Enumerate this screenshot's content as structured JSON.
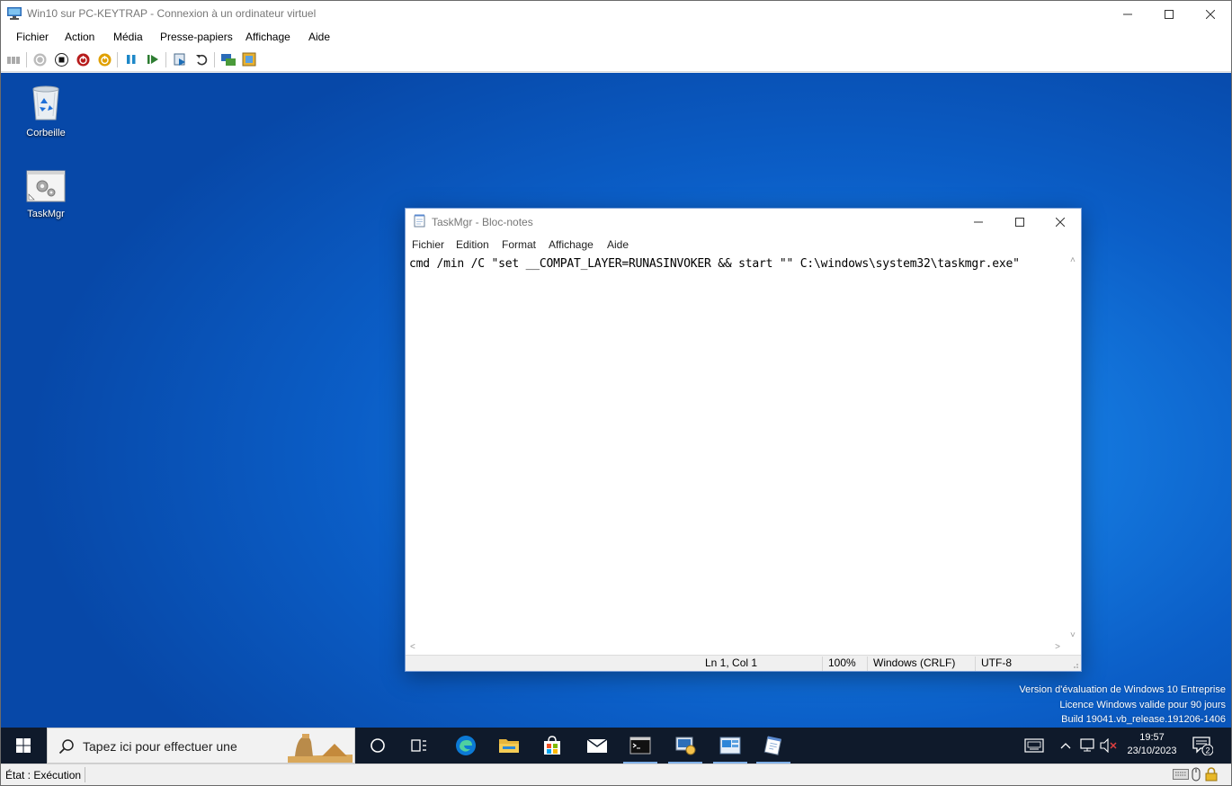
{
  "host_window": {
    "title": "Win10 sur PC-KEYTRAP - Connexion à un ordinateur virtuel",
    "menu": [
      "Fichier",
      "Action",
      "Média",
      "Presse-papiers",
      "Affichage",
      "Aide"
    ],
    "status": "État : Exécution"
  },
  "desktop": {
    "icons": [
      {
        "label": "Corbeille",
        "icon": "recycle-bin-icon"
      },
      {
        "label": "TaskMgr",
        "icon": "taskmgr-shortcut-icon"
      }
    ],
    "watermark": [
      "Version d'évaluation de Windows 10 Entreprise",
      "Licence Windows valide pour 90 jours",
      "Build 19041.vb_release.191206-1406"
    ]
  },
  "notepad": {
    "title": "TaskMgr - Bloc-notes",
    "menu": [
      "Fichier",
      "Edition",
      "Format",
      "Affichage",
      "Aide"
    ],
    "content": "cmd /min /C \"set __COMPAT_LAYER=RUNASINVOKER && start \"\" C:\\windows\\system32\\taskmgr.exe\"",
    "status": {
      "position": "Ln 1, Col 1",
      "zoom": "100%",
      "line_ending": "Windows (CRLF)",
      "encoding": "UTF-8"
    }
  },
  "taskbar": {
    "search_placeholder": "Tapez ici pour effectuer une",
    "time": "19:57",
    "date": "23/10/2023",
    "notification_count": "2"
  },
  "colors": {
    "desktop_blue": "#0b5ec7",
    "taskbar": "#0f1a2b"
  }
}
